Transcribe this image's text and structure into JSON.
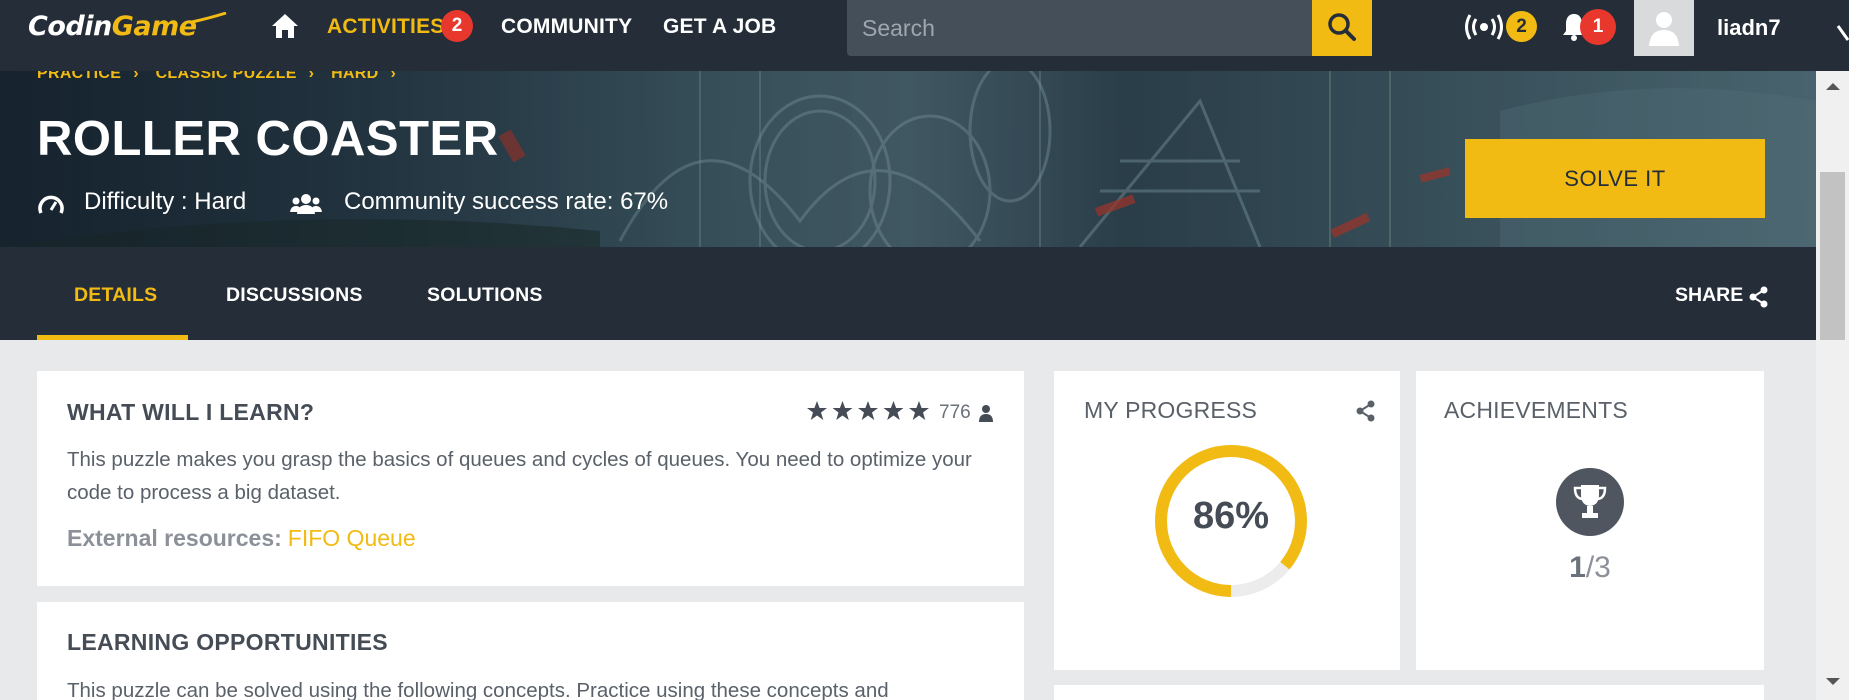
{
  "brand": {
    "logo_text_1": "Cod",
    "logo_text_2": "i",
    "logo_text_3": "n",
    "logo_text_4": "Game"
  },
  "nav": {
    "activities_label": "ACTIVITIES",
    "activities_badge": "2",
    "community_label": "COMMUNITY",
    "job_label": "GET A JOB",
    "search_placeholder": "Search",
    "broadcast_badge": "2",
    "notifications_badge": "1",
    "username": "liadn7"
  },
  "breadcrumb": [
    "PRACTICE",
    "CLASSIC PUZZLE",
    "HARD"
  ],
  "puzzle": {
    "title": "ROLLER COASTER",
    "difficulty": "Difficulty : Hard",
    "success_rate": "Community success rate: 67%",
    "solve_label": "SOLVE IT"
  },
  "tabs": {
    "details": "DETAILS",
    "discussions": "DISCUSSIONS",
    "solutions": "SOLUTIONS",
    "share": "SHARE"
  },
  "learn": {
    "heading": "WHAT WILL I LEARN?",
    "rating_count": "776",
    "rating_stars": 5,
    "description": "This puzzle makes you grasp the basics of queues and cycles of queues. You need to optimize your code to process a big dataset.",
    "resources_label": "External resources:",
    "resources_link": "FIFO Queue"
  },
  "opportunities": {
    "heading": "LEARNING OPPORTUNITIES",
    "text": "This puzzle can be solved using the following concepts. Practice using these concepts and"
  },
  "progress": {
    "heading": "MY PROGRESS",
    "percent_label": "86%",
    "percent_value": 86
  },
  "achievements": {
    "heading": "ACHIEVEMENTS",
    "earned": "1",
    "total": "/3"
  },
  "colors": {
    "accent": "#f2bb13",
    "nav_bg": "#252e38",
    "badge_red": "#e8372c",
    "page_bg": "#e8e9eb"
  },
  "icons": [
    "home-icon",
    "search-icon",
    "broadcast-icon",
    "bell-icon",
    "avatar-icon",
    "gauge-icon",
    "people-icon",
    "share-icon",
    "star-icon",
    "user-icon",
    "trophy-icon"
  ]
}
